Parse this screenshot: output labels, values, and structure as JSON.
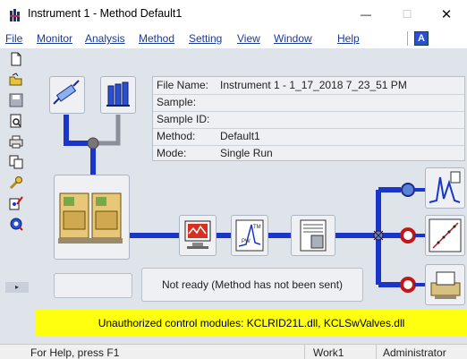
{
  "window": {
    "title": "Instrument 1 - Method  Default1",
    "minimize_glyph": "—",
    "maximize_glyph": "☐",
    "close_glyph": "✕"
  },
  "menu": [
    "File",
    "Monitor",
    "Analysis",
    "Method",
    "Setting",
    "View",
    "Window",
    "Help"
  ],
  "menu_extra_button": "A",
  "info": {
    "rows": [
      {
        "label": "File Name:",
        "value": "Instrument 1 - 1_17_2018 7_23_51 PM"
      },
      {
        "label": "Sample:",
        "value": ""
      },
      {
        "label": "Sample ID:",
        "value": ""
      },
      {
        "label": "Method:",
        "value": "Default1"
      },
      {
        "label": "Mode:",
        "value": "Single Run"
      }
    ]
  },
  "status_message": "Not ready (Method has not been sent)",
  "warning": "Unauthorized control modules: KCLRID21L.dll, KCLSwValves.dll",
  "statusbar": {
    "help": "For Help, press F1",
    "workspace": "Work1",
    "user": "Administrator"
  },
  "toolbar_icons": [
    "new-file-icon",
    "open-folder-icon",
    "save-icon",
    "print-preview-icon",
    "print-icon",
    "copy-icon",
    "wrench-icon",
    "method-wizard-icon",
    "settings-icon"
  ],
  "colors": {
    "accent_blue": "#1a3a99",
    "pipe_blue": "#1a35c8",
    "warning_yellow": "#ffff10"
  }
}
